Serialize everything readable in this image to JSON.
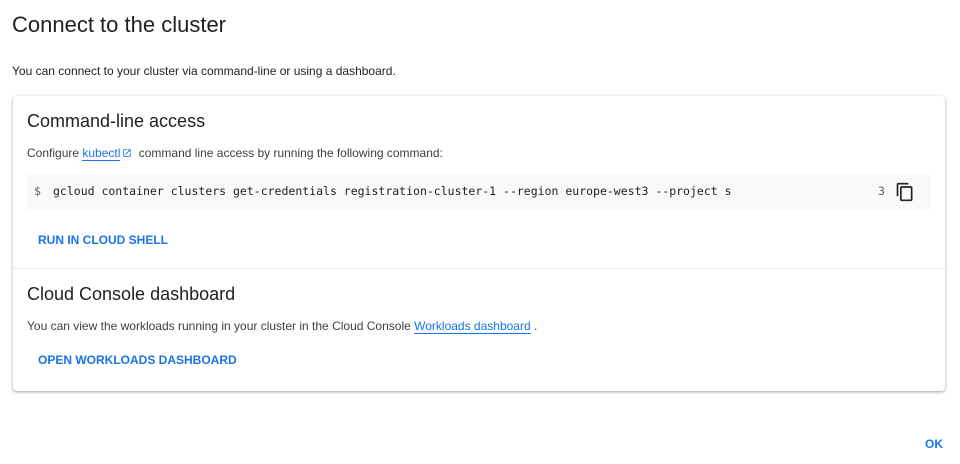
{
  "dialog": {
    "title": "Connect to the cluster",
    "subtitle": "You can connect to your cluster via command-line or using a dashboard.",
    "ok_label": "OK"
  },
  "cli_section": {
    "title": "Command-line access",
    "desc_prefix": "Configure ",
    "link_text": "kubectl",
    "desc_suffix": " command line access by running the following command:",
    "prompt": "$",
    "command": "gcloud container clusters get-credentials registration-cluster-1 --region europe-west3 --project s",
    "command_trail": "3",
    "run_button": "RUN IN CLOUD SHELL"
  },
  "dashboard_section": {
    "title": "Cloud Console dashboard",
    "desc_prefix": "You can view the workloads running in your cluster in the Cloud Console ",
    "link_text": "Workloads dashboard",
    "desc_suffix": " .",
    "open_button": "OPEN WORKLOADS DASHBOARD"
  },
  "icons": {
    "external_link": "external-link-icon",
    "copy": "copy-icon"
  },
  "colors": {
    "accent": "#1a73e8",
    "code_bg": "#f8f9fa",
    "text": "#202124"
  }
}
